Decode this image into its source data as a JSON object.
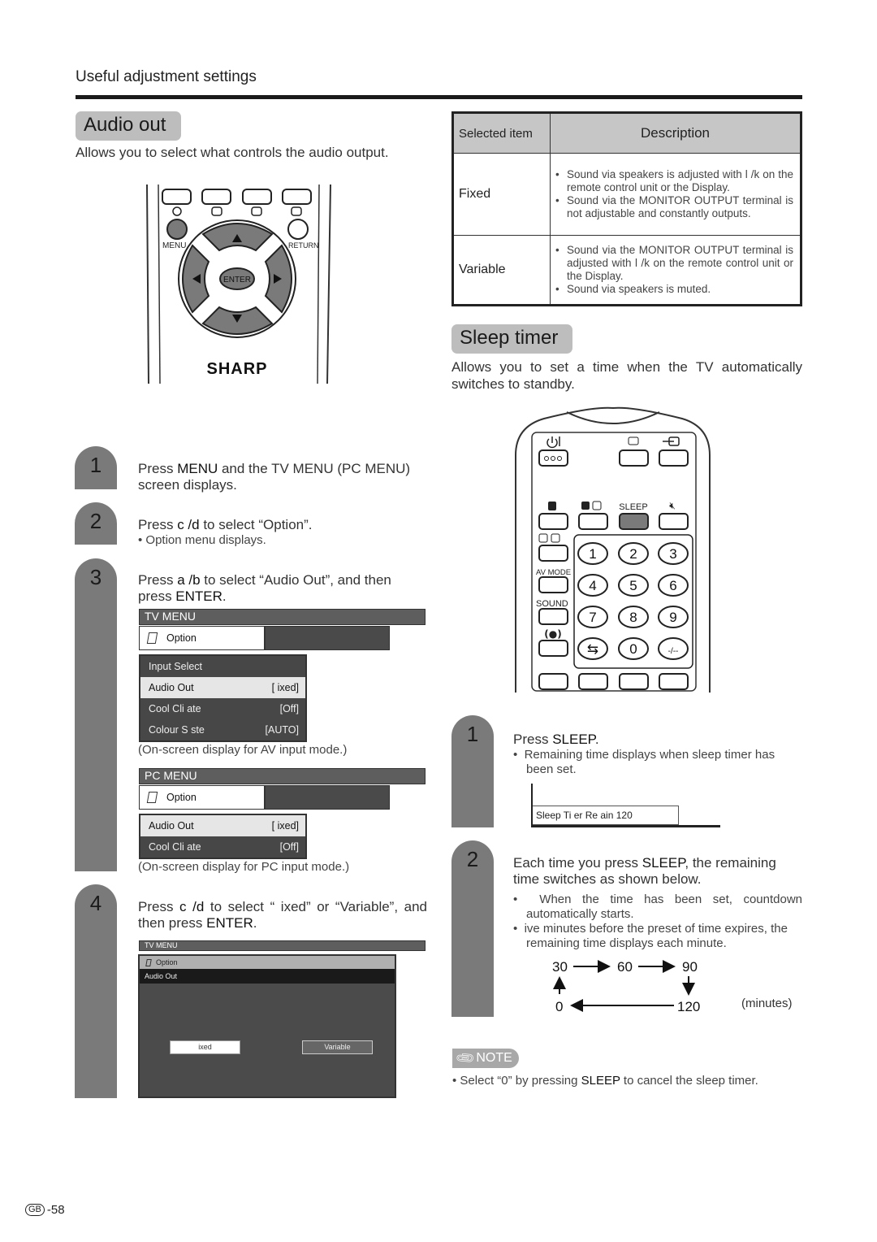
{
  "header": {
    "title": "Useful adjustment settings"
  },
  "audio_out": {
    "title": "Audio out",
    "description": "Allows you to select what controls the audio output.",
    "remote": {
      "brand": "SHARP",
      "labels": {
        "menu": "MENU",
        "return": "RETURN",
        "enter": "ENTER"
      }
    },
    "steps": [
      {
        "number": "1",
        "text_pre": "Press ",
        "key": "MENU",
        "text_post": " and the TV MENU (PC MENU) screen displays."
      },
      {
        "number": "2",
        "text_pre": "Press ",
        "key": "c /d",
        "text_post": "  to select “Option”.",
        "bullet": "Option menu displays."
      },
      {
        "number": "3",
        "text_pre": "Press ",
        "key": "a /b",
        "text_post": "  to select “Audio Out”, and then press ",
        "key2": "ENTER",
        "text_end": "."
      },
      {
        "number": "4",
        "text_pre": "Press ",
        "key": "c /d",
        "text_post": "  to select “ ixed” or “Variable”, and then press ",
        "key2": "ENTER",
        "text_end": "."
      }
    ],
    "tv_menu": {
      "title": "TV MENU",
      "tab": "Option",
      "items": [
        {
          "label": "Input Select",
          "value": ""
        },
        {
          "label": "Audio Out",
          "value": "[  ixed]",
          "selected": true
        },
        {
          "label": "Cool Cli   ate",
          "value": "[Off]"
        },
        {
          "label": "Colour S  ste",
          "value": "[AUTO]"
        }
      ],
      "caption": "(On-screen display for AV input mode.)"
    },
    "pc_menu": {
      "title": "PC MENU",
      "tab": "Option",
      "items": [
        {
          "label": "Audio Out",
          "value": "[  ixed]",
          "selected": true
        },
        {
          "label": "Cool Cli   ate",
          "value": "[Off]"
        }
      ],
      "caption": "(On-screen display for PC input mode.)"
    },
    "audio_out_menu": {
      "title": "TV MENU",
      "tab": "Option",
      "subtitle": "Audio Out",
      "options": [
        "ixed",
        "Variable"
      ]
    },
    "table": {
      "headers": [
        "Selected item",
        "Description"
      ],
      "rows": [
        {
          "item": "Fixed",
          "bullets": [
            "Sound via speakers is adjusted with       l  /k  on the remote control unit or the Display.",
            "Sound via the MONITOR OUTPUT terminal is not adjustable and constantly outputs."
          ]
        },
        {
          "item": "Variable",
          "bullets": [
            "Sound via the MONITOR OUTPUT terminal is adjusted with       l  /k  on the remote control unit or the Display.",
            "Sound via speakers is muted."
          ]
        }
      ]
    }
  },
  "sleep_timer": {
    "title": "Sleep timer",
    "description": "Allows you to set a time when the TV automatically switches to standby.",
    "remote": {
      "labels": {
        "sleep": "SLEEP",
        "av_mode": "AV MODE",
        "sound": "SOUND",
        "dash": "-/--"
      },
      "digits": [
        "1",
        "2",
        "3",
        "4",
        "5",
        "6",
        "7",
        "8",
        "9",
        "0"
      ]
    },
    "steps": [
      {
        "number": "1",
        "text_pre": "Press ",
        "key": "SLEEP",
        "text_post": ".",
        "bullet": "Remaining time displays when sleep timer has been set.",
        "osd": "Sleep Ti   er  Re   ain 120"
      },
      {
        "number": "2",
        "text_pre": "Each time you press ",
        "key": "SLEEP",
        "text_post": ", the remaining time switches as shown below.",
        "bullets": [
          "When the time has been set, countdown automatically starts.",
          " ive minutes before the preset of time expires, the remaining time displays each minute."
        ]
      }
    ],
    "cycle": {
      "values": [
        "30",
        "60",
        "90",
        "120",
        "0"
      ],
      "unit": "(minutes)"
    },
    "note": {
      "label": "NOTE",
      "text_pre": "Select “0” by pressing ",
      "key": "SLEEP",
      "text_post": " to cancel the sleep timer."
    }
  },
  "footer": {
    "region": "GB",
    "page": "-58"
  }
}
